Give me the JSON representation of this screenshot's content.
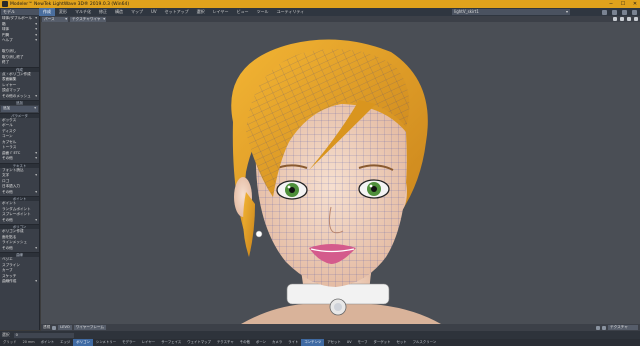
{
  "window": {
    "title": "Modeler™ NewTek LightWave 3D® 2019.0.3 (Win64)",
    "controls": [
      "─",
      "☐",
      "✕"
    ]
  },
  "menubar": {
    "mode": "モデル",
    "tabs": [
      "作成",
      "変形",
      "マルチ化",
      "修正",
      "構造",
      "マップ",
      "UV",
      "セットアップ",
      "選択",
      "レイヤー",
      "ビュー",
      "ツール",
      "ユーティリティ"
    ],
    "active_tab": 0,
    "layer": "lightV_skirt1",
    "icons": [
      "settings-icon",
      "help-icon",
      "grid-icon",
      "close-icon"
    ]
  },
  "sidebar": {
    "items": [
      {
        "type": "item",
        "label": "球体/ダブルボール",
        "dd": true
      },
      {
        "type": "item",
        "label": "箱",
        "dd": true
      },
      {
        "type": "item",
        "label": "球体",
        "dd": true
      },
      {
        "type": "item",
        "label": "円筒",
        "dd": true
      },
      {
        "type": "item",
        "label": "ヘルプ",
        "dd": true
      },
      {
        "type": "item",
        "label": "",
        "dd": false
      },
      {
        "type": "item",
        "label": "取り消し",
        "dd": false
      },
      {
        "type": "item",
        "label": "取り消し終了",
        "dd": false
      },
      {
        "type": "item",
        "label": "終了",
        "dd": false
      },
      {
        "type": "head",
        "label": "作成"
      },
      {
        "type": "item",
        "label": "点・ポリゴン作成",
        "dd": false
      },
      {
        "type": "item",
        "label": "表面編集",
        "dd": false
      },
      {
        "type": "item",
        "label": "レイヤー",
        "dd": false
      },
      {
        "type": "item",
        "label": "頂点マップ",
        "dd": false
      },
      {
        "type": "item",
        "label": "その他のメッシュ",
        "dd": true
      },
      {
        "type": "head",
        "label": "追加"
      },
      {
        "type": "drop",
        "label": "追加"
      },
      {
        "type": "head",
        "label": "パラメータ"
      },
      {
        "type": "item",
        "label": "ボックス",
        "dd": false
      },
      {
        "type": "item",
        "label": "ボール",
        "dd": false
      },
      {
        "type": "item",
        "label": "ディスク",
        "dd": false
      },
      {
        "type": "item",
        "label": "コーン",
        "dd": false
      },
      {
        "type": "item",
        "label": "カプセル",
        "dd": false
      },
      {
        "type": "item",
        "label": "トーラス",
        "dd": false
      },
      {
        "type": "item",
        "label": "曲面 Γ ETC",
        "dd": true
      },
      {
        "type": "item",
        "label": "その他",
        "dd": true
      },
      {
        "type": "head",
        "label": "テキスト"
      },
      {
        "type": "item",
        "label": "フォント読込",
        "dd": false
      },
      {
        "type": "item",
        "label": "文字",
        "dd": true
      },
      {
        "type": "item",
        "label": "ロゴ",
        "dd": false
      },
      {
        "type": "item",
        "label": "日本語入力",
        "dd": false
      },
      {
        "type": "item",
        "label": "その他",
        "dd": true
      },
      {
        "type": "head",
        "label": "ポイント"
      },
      {
        "type": "item",
        "label": "ポイント",
        "dd": false
      },
      {
        "type": "item",
        "label": "ランダムポイント",
        "dd": false
      },
      {
        "type": "item",
        "label": "スプレーポイント",
        "dd": false
      },
      {
        "type": "item",
        "label": "その他",
        "dd": true
      },
      {
        "type": "head",
        "label": "ポリゴン"
      },
      {
        "type": "item",
        "label": "ポリゴン作成",
        "dd": false
      },
      {
        "type": "item",
        "label": "面を貼る",
        "dd": false
      },
      {
        "type": "item",
        "label": "ラインメッシュ",
        "dd": false
      },
      {
        "type": "item",
        "label": "その他",
        "dd": true
      },
      {
        "type": "head",
        "label": "曲線"
      },
      {
        "type": "item",
        "label": "ベジエ",
        "dd": false
      },
      {
        "type": "item",
        "label": "スプライン",
        "dd": false
      },
      {
        "type": "item",
        "label": "カーブ",
        "dd": false
      },
      {
        "type": "item",
        "label": "スケッチ",
        "dd": false
      },
      {
        "type": "item",
        "label": "曲線作成",
        "dd": true
      }
    ]
  },
  "viewport": {
    "view": "パース",
    "shading": "テクスチャワイヤ",
    "icons": [
      "move-view-icon",
      "rotate-view-icon",
      "zoom-view-icon",
      "maximize-icon"
    ],
    "footer": {
      "label": "透視",
      "dd1": "LEVO",
      "dd2": "ワイヤーフレーム",
      "right_dd": "テクスチャ"
    }
  },
  "statusbar": {
    "select_label": "選択",
    "select_value": "0",
    "grid_label": "グリッド",
    "grid_value": "20 mm"
  },
  "bottombar": {
    "buttons": [
      "ポイント",
      "エッジ",
      "ポリゴン",
      "シンメトリー",
      "モデラー",
      "レイヤー",
      "サーフェイス",
      "ウェイトマップ",
      "テクスチャ",
      "その他",
      "ボーン",
      "カメラ",
      "ライト",
      "コンテンツ",
      "アセット",
      "UV",
      "モーフ",
      "ターゲット",
      "セット",
      "フルスクリーン"
    ],
    "active": [
      2,
      13
    ]
  },
  "colors": {
    "titlebar": "#e0a21c",
    "accent": "#4a6e9e",
    "hair": "#e8a623",
    "skin": "#f2d6c4",
    "eye": "#4e8f3a",
    "lips": "#d45b8c",
    "wire": "#3a4aa8"
  }
}
